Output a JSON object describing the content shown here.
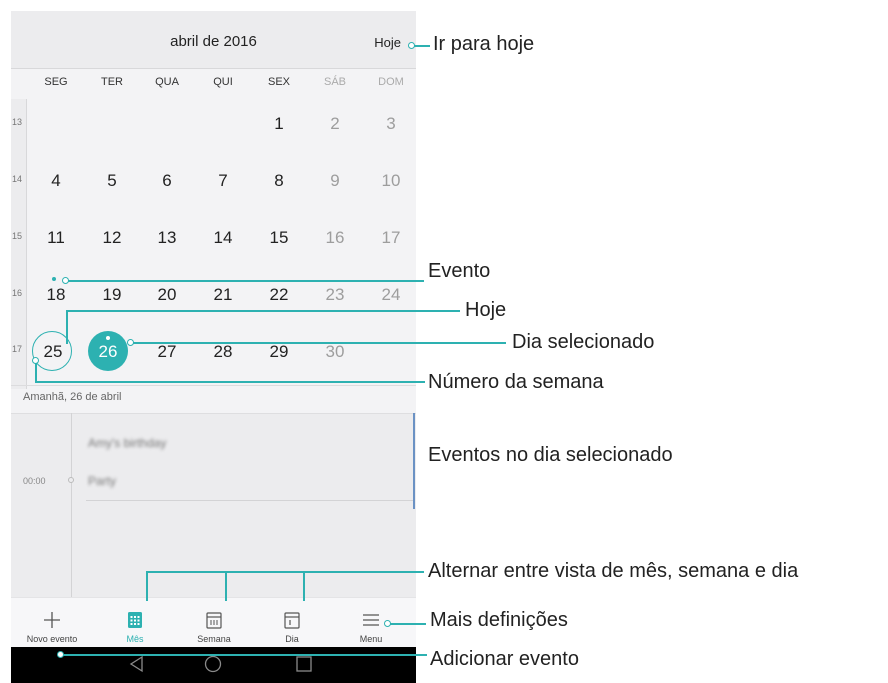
{
  "header": {
    "month": "abril de 2016",
    "today_button": "Hoje"
  },
  "weekdays": [
    "SEG",
    "TER",
    "QUA",
    "QUI",
    "SEX",
    "SÁB",
    "DOM"
  ],
  "weeks": [
    {
      "num": "13",
      "days": [
        "",
        "",
        "",
        "",
        "1",
        "2",
        "3"
      ]
    },
    {
      "num": "14",
      "days": [
        "4",
        "5",
        "6",
        "7",
        "8",
        "9",
        "10"
      ]
    },
    {
      "num": "15",
      "days": [
        "11",
        "12",
        "13",
        "14",
        "15",
        "16",
        "17"
      ]
    },
    {
      "num": "16",
      "days": [
        "18",
        "19",
        "20",
        "21",
        "22",
        "23",
        "24"
      ]
    },
    {
      "num": "17",
      "days": [
        "25",
        "26",
        "27",
        "28",
        "29",
        "30",
        ""
      ]
    }
  ],
  "today_day": "25",
  "selected_day": "26",
  "selected_date_label": "Amanhã, 26 de abril",
  "events": {
    "time": "00:00",
    "items": [
      "Amy's birthday",
      "Party"
    ]
  },
  "nav": [
    {
      "label": "Novo evento",
      "icon": "plus-icon"
    },
    {
      "label": "Mês",
      "icon": "month-grid-icon",
      "active": true
    },
    {
      "label": "Semana",
      "icon": "week-calendar-icon"
    },
    {
      "label": "Dia",
      "icon": "day-calendar-icon"
    },
    {
      "label": "Menu",
      "icon": "menu-icon"
    }
  ],
  "system_nav": [
    "back-icon",
    "home-icon",
    "recents-icon"
  ],
  "colors": {
    "accent": "#2db1b1",
    "event_bar": "#6b92c4"
  },
  "callouts": {
    "go_today": "Ir para hoje",
    "event": "Evento",
    "today": "Hoje",
    "selected_day": "Dia selecionado",
    "week_number": "Número da semana",
    "events_on_selected_day": "Eventos no dia selecionado",
    "switch_views": "Alternar entre vista de mês, semana e dia",
    "more_settings": "Mais definições",
    "add_event": "Adicionar evento"
  }
}
